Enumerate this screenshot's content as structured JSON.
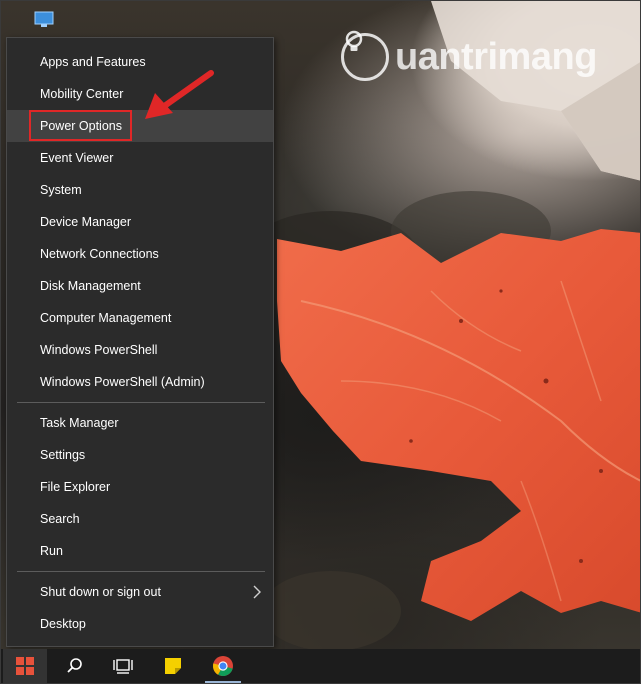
{
  "watermark": {
    "text": "uantrimang"
  },
  "menu": {
    "groups": [
      {
        "items": [
          {
            "label": "Apps and Features"
          },
          {
            "label": "Mobility Center"
          },
          {
            "label": "Power Options",
            "state": "hovered",
            "annotation": "red-highlight"
          },
          {
            "label": "Event Viewer"
          },
          {
            "label": "System"
          },
          {
            "label": "Device Manager"
          },
          {
            "label": "Network Connections"
          },
          {
            "label": "Disk Management"
          },
          {
            "label": "Computer Management"
          },
          {
            "label": "Windows PowerShell"
          },
          {
            "label": "Windows PowerShell (Admin)"
          }
        ]
      },
      {
        "items": [
          {
            "label": "Task Manager"
          },
          {
            "label": "Settings"
          },
          {
            "label": "File Explorer"
          },
          {
            "label": "Search"
          },
          {
            "label": "Run"
          }
        ]
      },
      {
        "items": [
          {
            "label": "Shut down or sign out",
            "submenu": true
          },
          {
            "label": "Desktop"
          }
        ]
      }
    ]
  },
  "taskbar": {
    "buttons": [
      {
        "icon": "windows-logo-icon"
      },
      {
        "icon": "search-icon"
      },
      {
        "icon": "task-view-icon"
      },
      {
        "icon": "sticky-notes-icon"
      },
      {
        "icon": "chrome-icon",
        "active": true
      }
    ]
  },
  "colors": {
    "menu_bg": "#2b2b2b",
    "menu_hover": "#424242",
    "highlight_border": "#e02727",
    "arrow": "#e02727",
    "taskbar_bg": "#1c1c1c",
    "start_accent": "#e8523b",
    "sticky_yellow": "#f5d000"
  }
}
